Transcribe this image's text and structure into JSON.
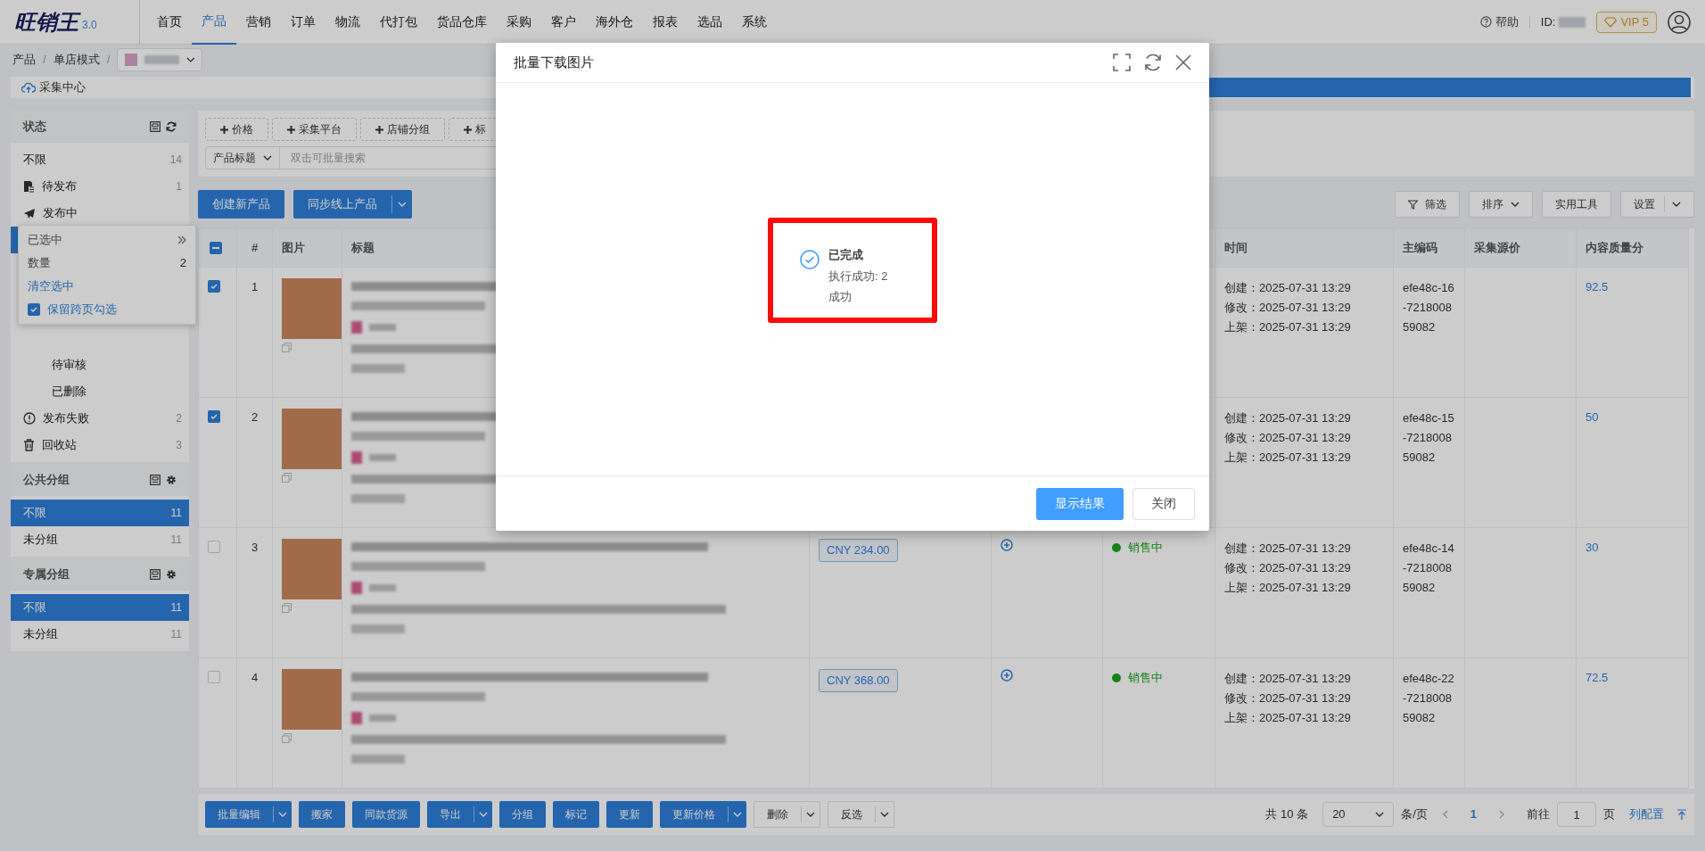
{
  "app": {
    "logo": "旺销王",
    "version": "3.0"
  },
  "nav": [
    {
      "label": "首页",
      "selected": false
    },
    {
      "label": "产品",
      "selected": true
    },
    {
      "label": "营销",
      "selected": false
    },
    {
      "label": "订单",
      "selected": false
    },
    {
      "label": "物流",
      "selected": false
    },
    {
      "label": "代打包",
      "selected": false
    },
    {
      "label": "货品仓库",
      "selected": false
    },
    {
      "label": "采购",
      "selected": false
    },
    {
      "label": "客户",
      "selected": false
    },
    {
      "label": "海外仓",
      "selected": false
    },
    {
      "label": "报表",
      "selected": false
    },
    {
      "label": "选品",
      "selected": false
    },
    {
      "label": "系统",
      "selected": false
    }
  ],
  "header_right": {
    "help": "帮助",
    "id_label": "ID:",
    "vip": "VIP 5"
  },
  "breadcrumb": {
    "items": [
      "产品",
      "单店模式"
    ],
    "separator": "/"
  },
  "page_tab": {
    "label": "采集中心"
  },
  "sidebar": [
    {
      "title": "状态",
      "items": [
        {
          "label": "不限",
          "count": "14",
          "kind": "plain",
          "selected": false
        },
        {
          "label": "待发布",
          "count": "1",
          "kind": "draft",
          "selected": false
        },
        {
          "label": "发布中",
          "kind": "publishing",
          "selected": false
        },
        {
          "label": "待审核",
          "kind": "sub",
          "selected": false
        },
        {
          "label": "已删除",
          "kind": "sub",
          "selected": false
        },
        {
          "label": "发布失败",
          "count": "2",
          "kind": "failed",
          "selected": false
        },
        {
          "label": "回收站",
          "count": "3",
          "kind": "recycle",
          "selected": false
        }
      ]
    },
    {
      "title": "公共分组",
      "items": [
        {
          "label": "不限",
          "count": "11",
          "kind": "plain",
          "selected": true
        },
        {
          "label": "未分组",
          "count": "11",
          "kind": "plain",
          "selected": false
        }
      ]
    },
    {
      "title": "专属分组",
      "items": [
        {
          "label": "不限",
          "count": "11",
          "kind": "plain",
          "selected": true
        },
        {
          "label": "未分组",
          "count": "11",
          "kind": "plain",
          "selected": false
        }
      ]
    }
  ],
  "selection_popup": {
    "title": "已选中",
    "count_label": "数量",
    "count": "2",
    "clear": "清空选中",
    "keep_label": "保留跨页勾选",
    "keep_checked": true
  },
  "filter_tags": [
    "价格",
    "采集平台",
    "店铺分组",
    "标"
  ],
  "search": {
    "field": "产品标题",
    "placeholder": "双击可批量搜索"
  },
  "toolbar_left": [
    {
      "label": "创建新产品",
      "split": false
    },
    {
      "label": "同步线上产品",
      "split": true
    }
  ],
  "toolbar_right": [
    {
      "label": "筛选",
      "kind": "filter"
    },
    {
      "label": "排序",
      "kind": "dropdown"
    },
    {
      "label": "实用工具",
      "kind": "plain"
    },
    {
      "label": "设置",
      "kind": "split"
    }
  ],
  "table": {
    "header_indeterminate": true,
    "columns": [
      "#",
      "图片",
      "标题",
      "时间",
      "主编码",
      "采集源价",
      "内容质量分"
    ],
    "rows": [
      {
        "num": "1",
        "checked": true,
        "times": [
          "创建：2025-07-31 13:29",
          "修改：2025-07-31 13:29",
          "上架：2025-07-31 13:29"
        ],
        "code": "efe48c-16-721800859082",
        "score": "92.5"
      },
      {
        "num": "2",
        "checked": true,
        "times": [
          "创建：2025-07-31 13:29",
          "修改：2025-07-31 13:29",
          "上架：2025-07-31 13:29"
        ],
        "code": "efe48c-15-721800859082",
        "score": "50"
      },
      {
        "num": "3",
        "checked": false,
        "price": "CNY 234.00",
        "status": "销售中",
        "times": [
          "创建：2025-07-31 13:29",
          "修改：2025-07-31 13:29",
          "上架：2025-07-31 13:29"
        ],
        "code": "efe48c-14-721800859082",
        "score": "30"
      },
      {
        "num": "4",
        "checked": false,
        "price": "CNY 368.00",
        "status": "销售中",
        "times": [
          "创建：2025-07-31 13:29",
          "修改：2025-07-31 13:29",
          "上架：2025-07-31 13:29"
        ],
        "code": "efe48c-22-721800859082",
        "score": "72.5"
      }
    ]
  },
  "bottom_actions": [
    {
      "label": "批量编辑",
      "kind": "primary",
      "split": true
    },
    {
      "label": "搬家",
      "kind": "primary",
      "split": false
    },
    {
      "label": "同款货源",
      "kind": "primary",
      "split": false
    },
    {
      "label": "导出",
      "kind": "primary",
      "split": true
    },
    {
      "label": "分组",
      "kind": "primary",
      "split": false
    },
    {
      "label": "标记",
      "kind": "primary",
      "split": false
    },
    {
      "label": "更新",
      "kind": "primary",
      "split": false
    },
    {
      "label": "更新价格",
      "kind": "primary",
      "split": true
    },
    {
      "label": "删除",
      "kind": "plain",
      "split": true
    },
    {
      "label": "反选",
      "kind": "plain",
      "split": true
    }
  ],
  "pagination": {
    "total": "共 10 条",
    "page_size": "20",
    "per_page": "条/页",
    "current": "1",
    "goto": "前往",
    "goto_value": "1",
    "page_unit": "页",
    "columns_link": "列配置"
  },
  "dialog": {
    "title": "批量下载图片",
    "result_title": "已完成",
    "result_detail": "执行成功: 2",
    "result_status": "成功",
    "buttons": [
      {
        "label": "显示结果",
        "kind": "primary"
      },
      {
        "label": "关闭",
        "kind": "plain"
      }
    ]
  }
}
